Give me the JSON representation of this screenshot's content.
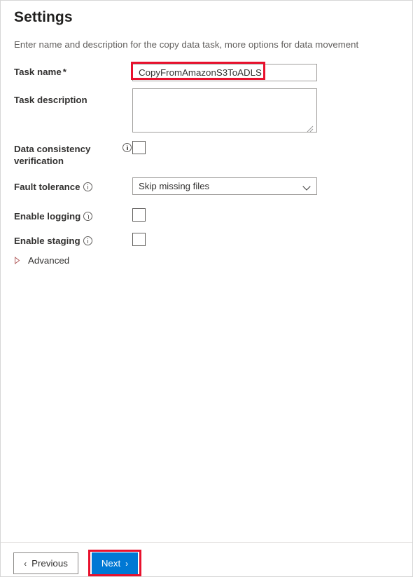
{
  "window": {
    "title": "Settings",
    "subtitle": "Enter name and description for the copy data task, more options for data movement"
  },
  "fields": {
    "task_name": {
      "label": "Task name",
      "required_marker": "*",
      "value": "CopyFromAmazonS3ToADLS",
      "placeholder": ""
    },
    "task_description": {
      "label": "Task description",
      "value": "",
      "placeholder": ""
    },
    "data_consistency": {
      "label": "Data consistency verification",
      "checked": false,
      "info_icon": "info-circle-icon"
    },
    "fault_tolerance": {
      "label": "Fault tolerance",
      "selected": "Skip missing files",
      "info_icon": "info-circle-icon",
      "chevron": "chevron-down-icon"
    },
    "enable_logging": {
      "label": "Enable logging",
      "checked": false,
      "info_icon": "info-circle-icon"
    },
    "enable_staging": {
      "label": "Enable staging",
      "checked": false,
      "info_icon": "info-circle-icon"
    },
    "advanced": {
      "label": "Advanced",
      "expanded": false,
      "chevron": "triangle-right-icon"
    }
  },
  "footer": {
    "previous_label": "Previous",
    "previous_chevron": "‹",
    "next_label": "Next",
    "next_chevron": "›"
  },
  "colors": {
    "accent": "#0078D4",
    "annotation": "#E8112D",
    "label_text": "#323130",
    "muted_text": "#605E5C",
    "border": "#A19F9D",
    "window_border": "#D6D6D6"
  }
}
